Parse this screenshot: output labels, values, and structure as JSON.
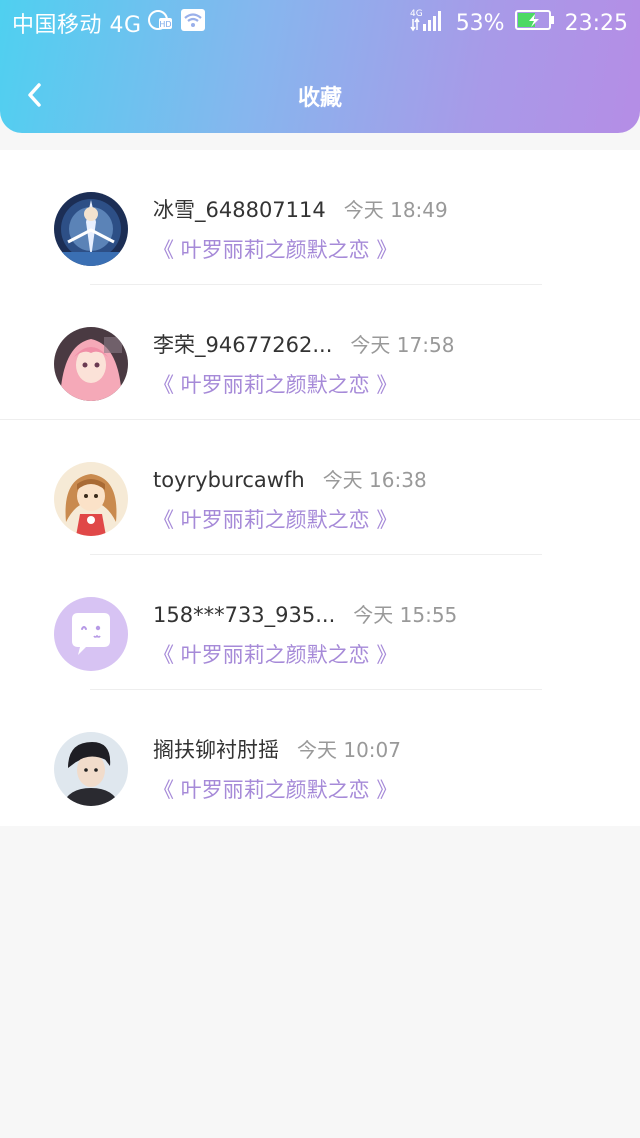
{
  "status_bar": {
    "carrier": "中国移动 4G",
    "network_badge": "4G",
    "battery": "53%",
    "time": "23:25"
  },
  "nav": {
    "title": "收藏"
  },
  "items": [
    {
      "username": "冰雪_648807114",
      "time": "今天 18:49",
      "title": "《 叶罗丽莉之颜默之恋 》",
      "avatar": "anime-warrior-avatar"
    },
    {
      "username": "李荣_94677262...",
      "time": "今天 17:58",
      "title": "《 叶罗丽莉之颜默之恋 》",
      "avatar": "pink-hair-girl-avatar"
    },
    {
      "username": "toyryburcawfh",
      "time": "今天 16:38",
      "title": "《 叶罗丽莉之颜默之恋 》",
      "avatar": "cartoon-girl-avatar"
    },
    {
      "username": "158***733_935...",
      "time": "今天 15:55",
      "title": "《 叶罗丽莉之颜默之恋 》",
      "avatar": "default-chat-avatar"
    },
    {
      "username": "搁扶铆衬肘摇",
      "time": "今天 10:07",
      "title": "《 叶罗丽莉之颜默之恋 》",
      "avatar": "young-man-avatar"
    }
  ],
  "colors": {
    "header_start": "#4fd0f0",
    "header_end": "#b58de6",
    "accent_title": "#a68ad8",
    "default_avatar_bg": "#d7c3f3"
  }
}
